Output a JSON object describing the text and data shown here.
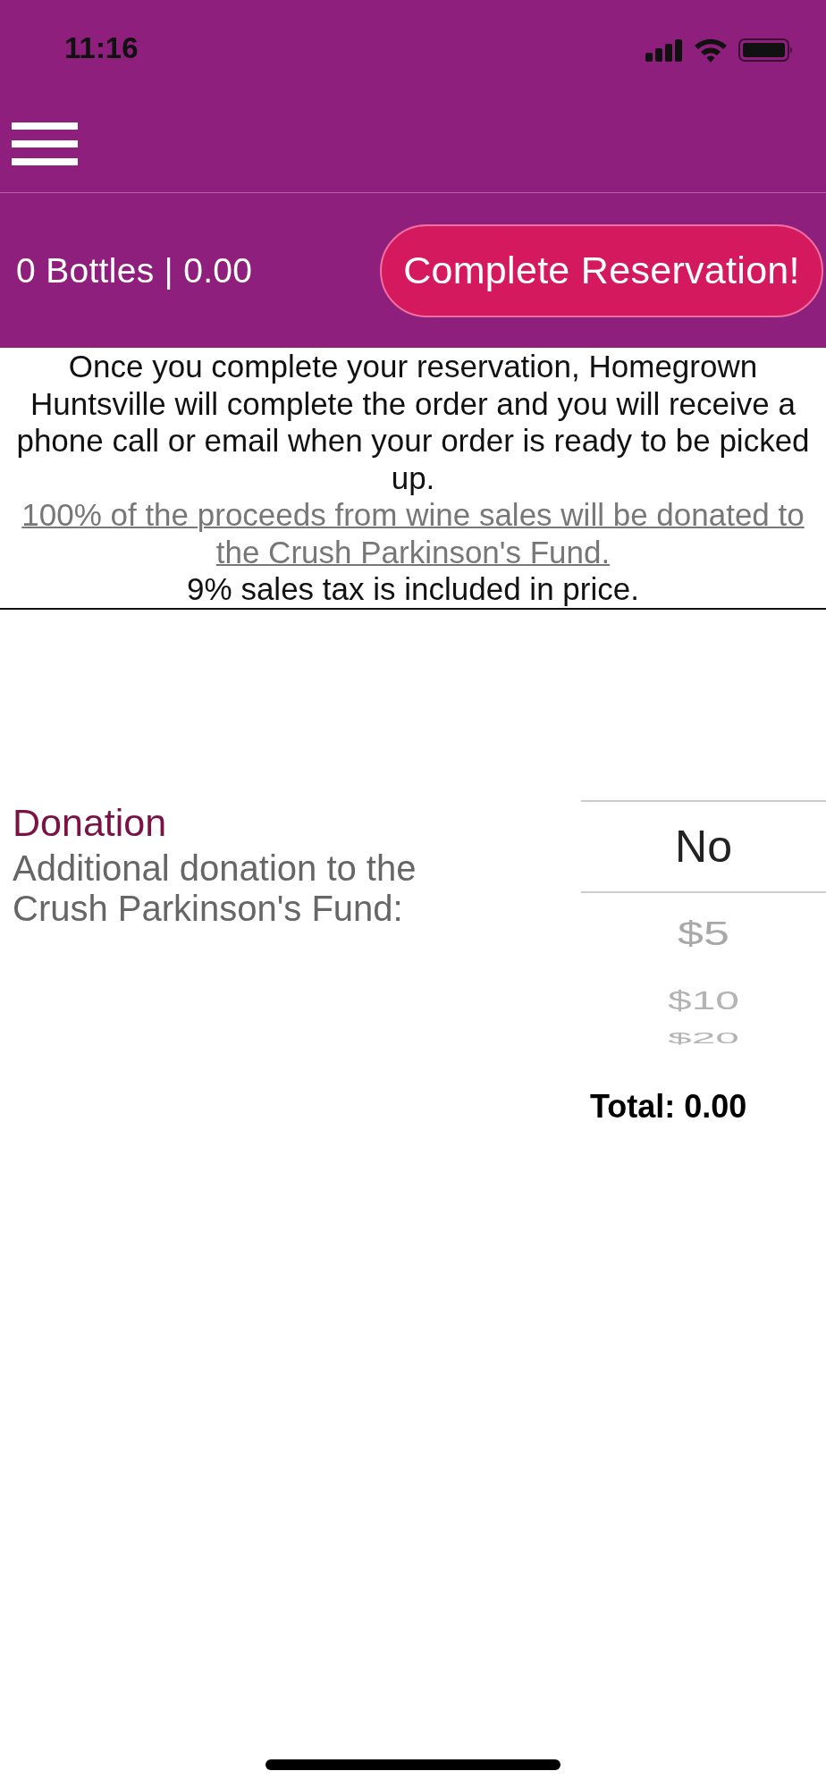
{
  "status_bar": {
    "time": "11:16"
  },
  "header": {
    "summary": "0 Bottles | 0.00",
    "button": "Complete Reservation!"
  },
  "info": {
    "paragraphs": [
      {
        "kind": "text",
        "text": "Once you complete your reservation, Homegrown Huntsville will complete the order and you will receive a phone call or email when your order is ready to be picked up."
      },
      {
        "kind": "link",
        "text": "100% of the proceeds from wine sales will be donated to the Crush Parkinson's Fund."
      },
      {
        "kind": "text",
        "text": "9% sales tax is included in price."
      }
    ]
  },
  "donation": {
    "title": "Donation",
    "description": "Additional donation to the Crush Parkinson's Fund:",
    "options": [
      {
        "label": "No",
        "selected": true
      },
      {
        "label": "$5",
        "selected": false
      },
      {
        "label": "$10",
        "selected": false
      },
      {
        "label": "$20",
        "selected": false
      }
    ],
    "total": "Total: 0.00"
  }
}
